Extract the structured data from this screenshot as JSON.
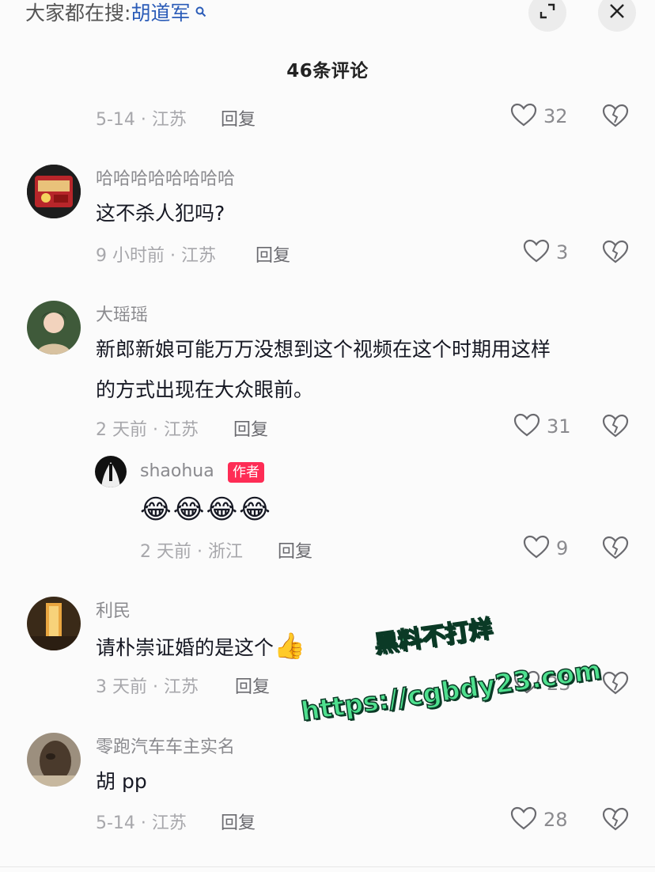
{
  "header": {
    "search_prefix": "大家都在搜:",
    "search_term": "胡道军",
    "comment_count_title": "46条评论"
  },
  "comments": [
    {
      "meta": "5-14 · 江苏",
      "reply_label": "回复",
      "likes": "32"
    },
    {
      "username": "哈哈哈哈哈哈哈哈",
      "text": "这不杀人犯吗?",
      "meta": "9 小时前 · 江苏",
      "reply_label": "回复",
      "likes": "3"
    },
    {
      "username": "大瑶瑶",
      "text_line1": "新郎新娘可能万万没想到这个视频在这个时期用这样",
      "text_line2": "的方式出现在大众眼前。",
      "meta": "2 天前 · 江苏",
      "reply_label": "回复",
      "likes": "31"
    },
    {
      "username": "shaohua",
      "badge": "作者",
      "emoji": "😂😂😂😂",
      "meta": "2 天前 · 浙江",
      "reply_label": "回复",
      "likes": "9"
    },
    {
      "username": "利民",
      "text": "请朴崇证婚的是这个",
      "emoji": "👍",
      "meta": "3 天前 · 江苏",
      "reply_label": "回复",
      "likes": "23"
    },
    {
      "username": "零跑汽车车主实名",
      "text": "胡 pp",
      "meta": "5-14 · 江苏",
      "reply_label": "回复",
      "likes": "28"
    }
  ],
  "watermark": {
    "line1": "黑料不打烊",
    "line2": "https://cgbdy23.com"
  },
  "icons": {
    "search": "search-icon",
    "expand": "expand-icon",
    "close": "close-icon",
    "like": "heart-outline-icon",
    "dislike": "broken-heart-icon"
  },
  "colors": {
    "accent_link": "#2b5cb8",
    "author_badge": "#fe2c55",
    "watermark": "#4ee08e"
  }
}
